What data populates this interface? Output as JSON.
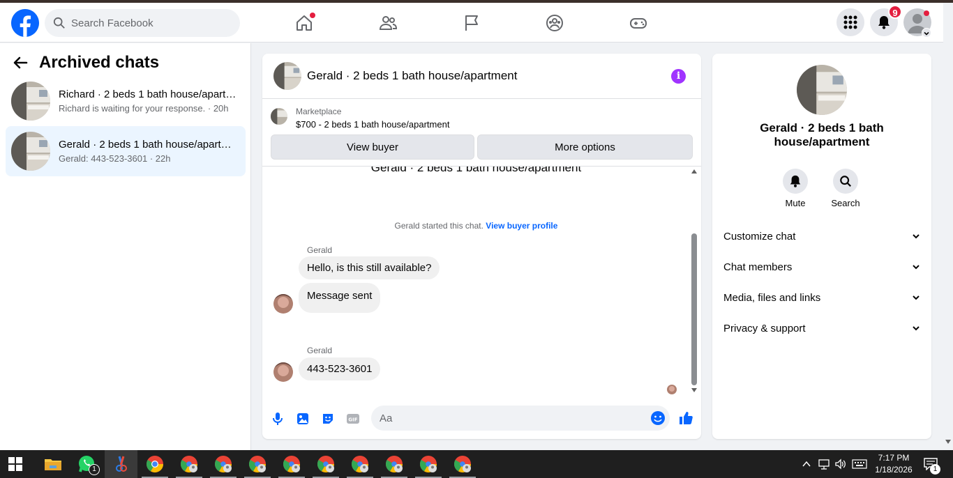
{
  "navbar": {
    "search_placeholder": "Search Facebook",
    "notifications_count": "9"
  },
  "sidebar": {
    "title": "Archived chats",
    "chats": [
      {
        "title": "Richard · 2 beds 1 bath house/apartment",
        "subtitle": "Richard is waiting for your response. · 20h"
      },
      {
        "title": "Gerald · 2 beds 1 bath house/apartment",
        "subtitle": "Gerald: 443-523-3601 · 22h"
      }
    ]
  },
  "conversation": {
    "title": "Gerald · 2 beds 1 bath house/apartment",
    "marketplace_label": "Marketplace",
    "listing": "$700 - 2 beds 1 bath house/apartment",
    "view_buyer": "View buyer",
    "more_options": "More options",
    "cut_title": "Gerald · 2 beds 1 bath house/apartment",
    "started_text": "Gerald started this chat.",
    "view_buyer_profile": "View buyer profile",
    "messages": [
      {
        "sender": "Gerald",
        "text": "Hello, is this still available?"
      },
      {
        "text": "Message sent"
      },
      {
        "sender": "Gerald",
        "text": "443-523-3601"
      }
    ],
    "composer_placeholder": "Aa"
  },
  "details": {
    "name": "Gerald · 2 beds 1 bath house/apartment",
    "mute": "Mute",
    "search": "Search",
    "sections": [
      "Customize chat",
      "Chat members",
      "Media, files and links",
      "Privacy & support"
    ]
  },
  "taskbar": {
    "time": "7:17 PM",
    "date": "1/18/2026",
    "whatsapp_badge": "1",
    "action_center_badge": "1"
  },
  "colors": {
    "brand": "#0866ff",
    "badge": "#e41e3f",
    "info": "#a033ff"
  }
}
